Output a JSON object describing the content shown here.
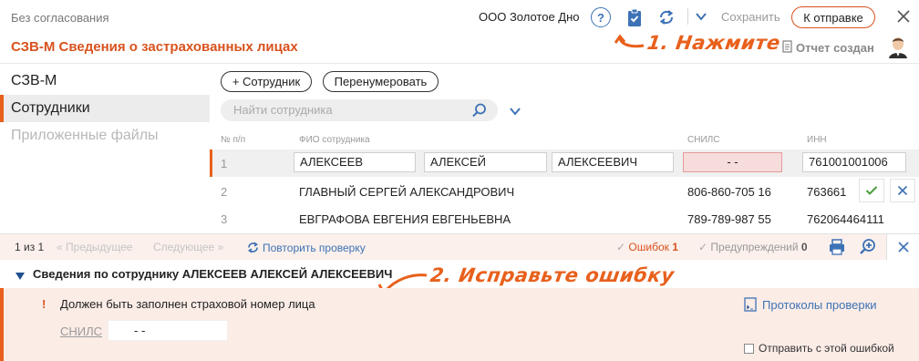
{
  "header": {
    "status": "Без согласования",
    "title": "СЗВ-М Сведения о застрахованных лицах",
    "org": "ООО Золотое Дно",
    "save_label": "Сохранить",
    "send_label": "К отправке",
    "report_status": "Отчет создан"
  },
  "annotations": {
    "step1": "1. Нажмите",
    "step2": "2. Исправьте ошибку"
  },
  "sidebar": {
    "items": [
      {
        "label": "СЗВ-М"
      },
      {
        "label": "Сотрудники"
      },
      {
        "label": "Приложенные файлы"
      }
    ]
  },
  "toolbar": {
    "add_label": "+ Сотрудник",
    "renumber_label": "Перенумеровать",
    "search_placeholder": "Найти сотрудника"
  },
  "table": {
    "headers": [
      "№ п/п",
      "ФИО сотрудника",
      "СНИЛС",
      "ИНН"
    ],
    "rows": [
      {
        "num": "1",
        "last": "АЛЕКСЕЕВ",
        "first": "АЛЕКСЕЙ",
        "middle": "АЛЕКСЕЕВИЧ",
        "snils": "-    -",
        "inn": "761001001006"
      },
      {
        "num": "2",
        "fio": "ГЛАВНЫЙ СЕРГЕЙ АЛЕКСАНДРОВИЧ",
        "snils": "806-860-705 16",
        "inn": "763661"
      },
      {
        "num": "3",
        "fio": "ЕВГРАФОВА ЕВГЕНИЯ ЕВГЕНЬЕВНА",
        "snils": "789-789-987 55",
        "inn": "762064464111"
      }
    ]
  },
  "statusbar": {
    "page": "1 из 1",
    "prev_label": "Предыдущее",
    "next_label": "Следующее",
    "recheck_label": "Повторить проверку",
    "errors_label": "Ошибок",
    "errors_count": "1",
    "warnings_label": "Предупреждений",
    "warnings_count": "0"
  },
  "error_panel": {
    "title": "Сведения по сотруднику АЛЕКСЕЕВ АЛЕКСЕЙ АЛЕКСЕЕВИЧ",
    "message": "Должен быть заполнен страховой номер лица",
    "protocols_label": "Протоколы проверки",
    "field_label": "СНИЛС",
    "field_value": "-    -",
    "send_with_error_label": "Отправить с этой ошибкой"
  },
  "colors": {
    "accent": "#e8601c",
    "blue": "#3d72b5",
    "error_bg": "#fbece6",
    "error_cell": "#f7dcdc"
  }
}
